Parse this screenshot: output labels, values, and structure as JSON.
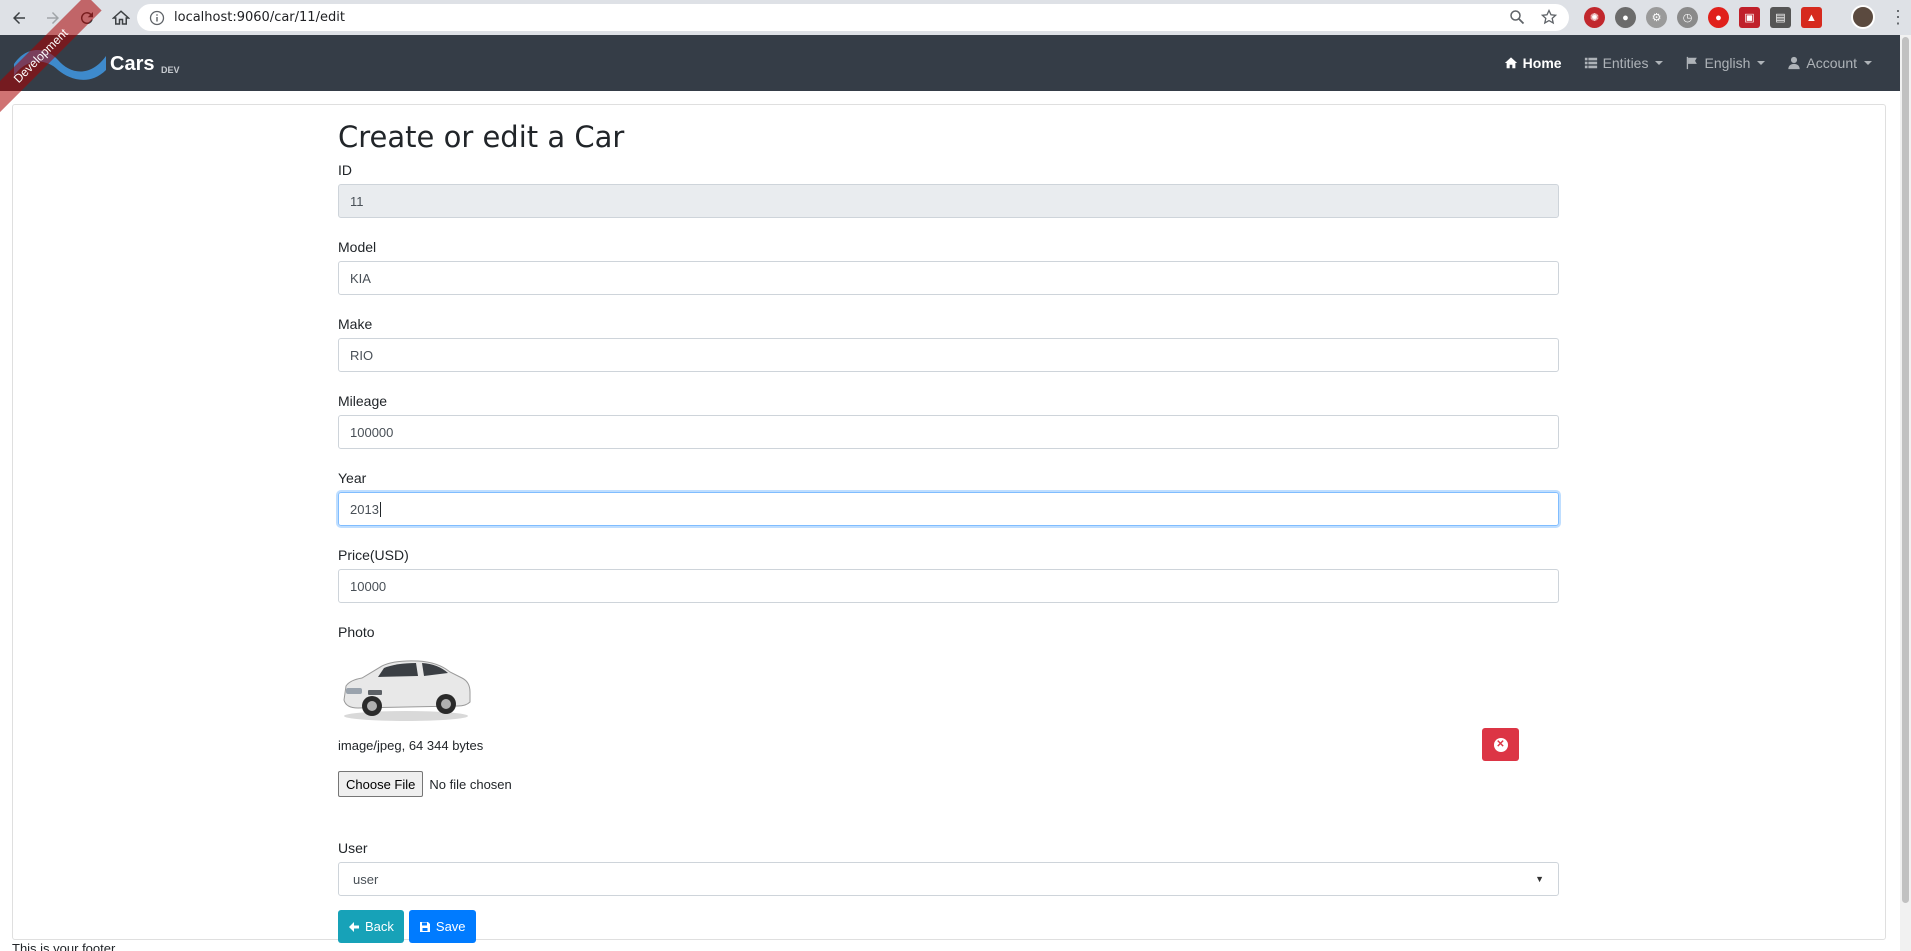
{
  "browser": {
    "url": "localhost:9060/car/11/edit"
  },
  "navbar": {
    "brand": "Cars",
    "version": "DEV",
    "ribbon": "Development",
    "items": [
      {
        "label": "Home",
        "icon": "home-icon",
        "active": true
      },
      {
        "label": "Entities",
        "icon": "list-icon",
        "dropdown": true
      },
      {
        "label": "English",
        "icon": "flag-icon",
        "dropdown": true
      },
      {
        "label": "Account",
        "icon": "user-icon",
        "dropdown": true
      }
    ]
  },
  "form": {
    "title": "Create or edit a Car",
    "id_label": "ID",
    "id_value": "11",
    "model_label": "Model",
    "model_value": "KIA",
    "make_label": "Make",
    "make_value": "RIO",
    "mileage_label": "Mileage",
    "mileage_value": "100000",
    "year_label": "Year",
    "year_value": "2013",
    "price_label": "Price(USD)",
    "price_value": "10000",
    "photo_label": "Photo",
    "photo_meta": "image/jpeg, 64 344 bytes",
    "choose_file_label": "Choose File",
    "no_file_text": "No file chosen",
    "user_label": "User",
    "user_value": "user",
    "back_label": "Back",
    "save_label": "Save"
  },
  "footer": {
    "text": "This is your footer"
  },
  "colors": {
    "navbar_bg": "#353d47",
    "back_button": "#17a2b8",
    "save_button": "#007bff",
    "remove_button": "#dc3545"
  }
}
